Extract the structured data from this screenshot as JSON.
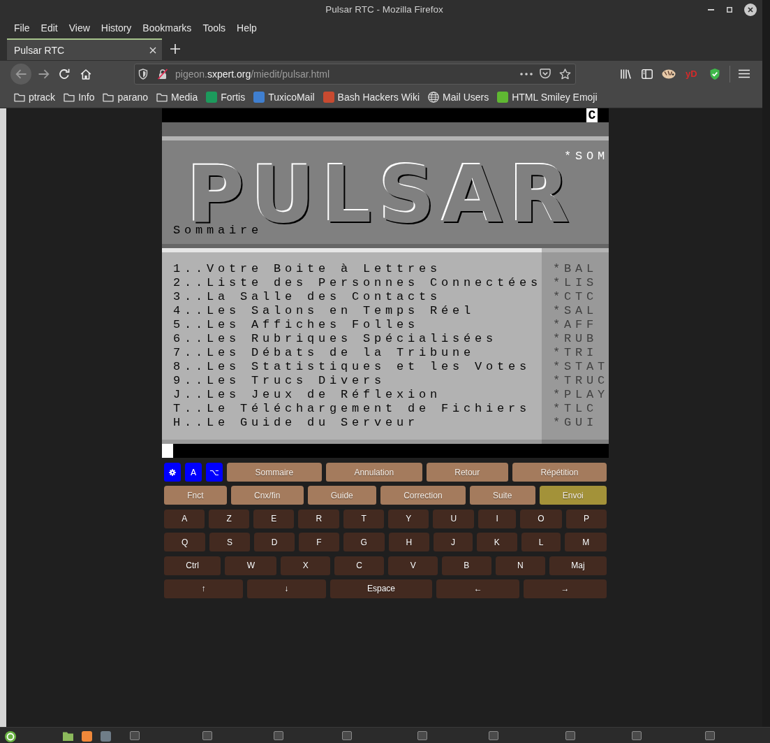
{
  "window": {
    "title": "Pulsar RTC - Mozilla Firefox"
  },
  "menu_bar": [
    "File",
    "Edit",
    "View",
    "History",
    "Bookmarks",
    "Tools",
    "Help"
  ],
  "tabs": [
    {
      "label": "Pulsar RTC",
      "selected": true
    }
  ],
  "navigation": {
    "back": {
      "disabled": true
    },
    "forward": {
      "disabled": true
    }
  },
  "address_bar": {
    "url": "pigeon.**sxpert.org**/miedit/pulsar.html"
  },
  "toolbar": {
    "extension_label": "yD"
  },
  "bookmarks": [
    {
      "label": "ptrack",
      "kind": "folder"
    },
    {
      "label": "Info",
      "kind": "folder"
    },
    {
      "label": "parano",
      "kind": "folder"
    },
    {
      "label": "Media",
      "kind": "folder"
    },
    {
      "label": "Fortis",
      "kind": "favicon",
      "color": "#1c9a5c"
    },
    {
      "label": "TuxicoMail",
      "kind": "favicon",
      "color": "#3f7fd0"
    },
    {
      "label": "Bash Hackers Wiki",
      "kind": "favicon",
      "color": "#c84a30"
    },
    {
      "label": "Mail Users",
      "kind": "globe"
    },
    {
      "label": "HTML Smiley Emoji",
      "kind": "favicon",
      "color": "#5fb832"
    }
  ],
  "minitel": {
    "status_indicator": "C",
    "page_code": "*SOM",
    "logo": "PULSAR",
    "page_title": "Sommaire",
    "menu": [
      {
        "label": "1..Votre Boite à Lettres",
        "code": "*BAL"
      },
      {
        "label": "2..Liste des Personnes Connectées",
        "code": "*LIS"
      },
      {
        "label": "3..La Salle des Contacts",
        "code": "*CTC"
      },
      {
        "label": "4..Les Salons en Temps Réel",
        "code": "*SAL"
      },
      {
        "label": "5..Les Affiches Folles",
        "code": "*AFF"
      },
      {
        "label": "6..Les Rubriques Spécialisées",
        "code": "*RUB"
      },
      {
        "label": "7..Les Débats de la Tribune",
        "code": "*TRI"
      },
      {
        "label": "8..Les Statistiques et les Votes",
        "code": "*STAT"
      },
      {
        "label": "9..Les Trucs Divers",
        "code": "*TRUC"
      },
      {
        "label": "J..Les Jeux de Réflexion",
        "code": "*PLAY"
      },
      {
        "label": "T..Le Téléchargement de Fichiers",
        "code": "*TLC"
      },
      {
        "label": "H..Le Guide du Serveur",
        "code": "*GUI"
      }
    ]
  },
  "keyboard": {
    "rows": [
      {
        "keys": [
          {
            "kind": "settings"
          },
          {
            "kind": "toggle",
            "label": "A"
          },
          {
            "kind": "toggle",
            "label": "⌥"
          },
          {
            "kind": "function",
            "label": "Sommaire"
          },
          {
            "kind": "function",
            "label": "Annulation"
          },
          {
            "kind": "function",
            "label": "Retour"
          },
          {
            "kind": "function",
            "label": "Répétition"
          }
        ]
      },
      {
        "keys": [
          {
            "kind": "function",
            "label": "Fnct"
          },
          {
            "kind": "function",
            "label": "Cnx/fin"
          },
          {
            "kind": "function",
            "label": "Guide"
          },
          {
            "kind": "function",
            "label": "Correction"
          },
          {
            "kind": "function",
            "label": "Suite"
          },
          {
            "kind": "send",
            "label": "Envoi"
          }
        ]
      },
      {
        "keys": [
          {
            "kind": "letter",
            "label": "A"
          },
          {
            "kind": "letter",
            "label": "Z"
          },
          {
            "kind": "letter",
            "label": "E"
          },
          {
            "kind": "letter",
            "label": "R"
          },
          {
            "kind": "letter",
            "label": "T"
          },
          {
            "kind": "letter",
            "label": "Y"
          },
          {
            "kind": "letter",
            "label": "U"
          },
          {
            "kind": "letter",
            "label": "I"
          },
          {
            "kind": "letter",
            "label": "O"
          },
          {
            "kind": "letter",
            "label": "P"
          }
        ]
      },
      {
        "keys": [
          {
            "kind": "letter",
            "label": "Q"
          },
          {
            "kind": "letter",
            "label": "S"
          },
          {
            "kind": "letter",
            "label": "D"
          },
          {
            "kind": "letter",
            "label": "F"
          },
          {
            "kind": "letter",
            "label": "G"
          },
          {
            "kind": "letter",
            "label": "H"
          },
          {
            "kind": "letter",
            "label": "J"
          },
          {
            "kind": "letter",
            "label": "K"
          },
          {
            "kind": "letter",
            "label": "L"
          },
          {
            "kind": "letter",
            "label": "M"
          }
        ]
      },
      {
        "keys": [
          {
            "kind": "letter",
            "label": "Ctrl"
          },
          {
            "kind": "letter",
            "label": "W"
          },
          {
            "kind": "letter",
            "label": "X"
          },
          {
            "kind": "letter",
            "label": "C"
          },
          {
            "kind": "letter",
            "label": "V"
          },
          {
            "kind": "letter",
            "label": "B"
          },
          {
            "kind": "letter",
            "label": "N"
          },
          {
            "kind": "letter",
            "label": "Maj"
          }
        ]
      },
      {
        "keys": [
          {
            "kind": "letter",
            "label": "↑"
          },
          {
            "kind": "letter",
            "label": "↓"
          },
          {
            "kind": "letter",
            "label": "Espace"
          },
          {
            "kind": "letter",
            "label": "←"
          },
          {
            "kind": "letter",
            "label": "→"
          }
        ]
      }
    ]
  }
}
